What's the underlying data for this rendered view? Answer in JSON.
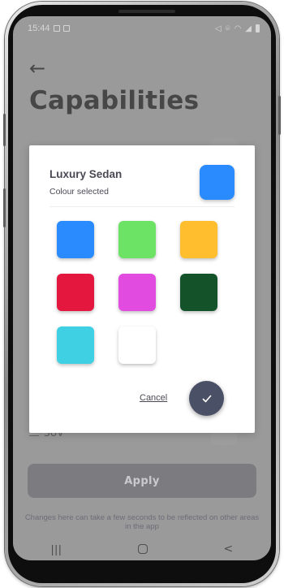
{
  "status_bar": {
    "time": "15:44",
    "left_icons": [
      "image-icon",
      "notification-icon"
    ],
    "right_icons": [
      "mute-icon",
      "location-icon",
      "wifi-icon",
      "signal-icon",
      "battery-icon"
    ]
  },
  "page": {
    "back_icon": "arrow-left-icon",
    "title": "Capabilities",
    "row_label": "SUV",
    "apply_label": "Apply",
    "footer_note": "Changes here can take a few seconds to be reflected on other areas in the app"
  },
  "dialog": {
    "title": "Luxury Sedan",
    "subtitle": "Colour selected",
    "selected_color": "#2A8BFF",
    "colors": [
      "#2A8BFF",
      "#6DE366",
      "#FFBE2E",
      "#E4183F",
      "#E24BE0",
      "#14532A",
      "#3FD1E3",
      "#FFFFFF"
    ],
    "cancel_label": "Cancel",
    "confirm_icon": "checkmark-icon"
  },
  "navbar": {
    "recent_icon": "recent-apps-icon",
    "home_icon": "home-icon",
    "back_icon": "back-chevron-icon"
  }
}
